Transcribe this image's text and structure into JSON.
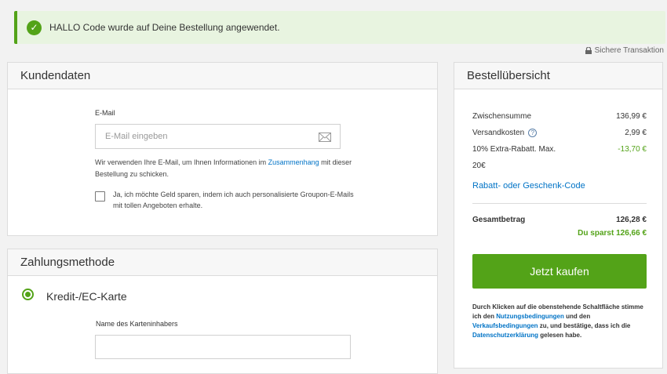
{
  "banner": {
    "text": "HALLO Code wurde auf Deine Bestellung angewendet."
  },
  "secure": {
    "text": "Sichere Transaktion"
  },
  "customer": {
    "title": "Kundendaten",
    "email_label": "E-Mail",
    "email_placeholder": "E-Mail eingeben",
    "help_pre": "Wir verwenden Ihre E-Mail, um Ihnen Informationen im ",
    "help_link": "Zusammenhang",
    "help_post": " mit dieser Bestellung zu schicken.",
    "optin": "Ja, ich möchte Geld sparen, indem ich auch personalisierte Groupon-E-Mails mit tollen Angeboten erhalte."
  },
  "payment": {
    "title": "Zahlungsmethode",
    "method": "Kredit-/EC-Karte",
    "holder_label": "Name des Karteninhabers"
  },
  "summary": {
    "title": "Bestellübersicht",
    "subtotal_label": "Zwischensumme",
    "subtotal_value": "136,99 €",
    "shipping_label": "Versandkosten",
    "shipping_value": "2,99 €",
    "discount_label": "10% Extra-Rabatt. Max.",
    "discount_value": "-13,70 €",
    "discount_label2": "20€",
    "promo_link": "Rabatt- oder Geschenk-Code",
    "total_label": "Gesamtbetrag",
    "total_value": "126,28 €",
    "savings": "Du sparst 126,66 €",
    "buy_button": "Jetzt kaufen",
    "legal": {
      "t1": "Durch Klicken auf die obenstehende Schaltfläche stimme ich den ",
      "l1": "Nutzungsbedingungen",
      "t2": " und den ",
      "l2": "Verkaufsbedingungen",
      "t3": " zu, und bestätige, dass ich die ",
      "l3": "Datenschutzerklärung",
      "t4": " gelesen habe."
    }
  },
  "colors": {
    "accent": "#53a318",
    "link": "#0073c6"
  },
  "icons": [
    "check-icon",
    "lock-icon",
    "mail-icon",
    "info-icon"
  ]
}
